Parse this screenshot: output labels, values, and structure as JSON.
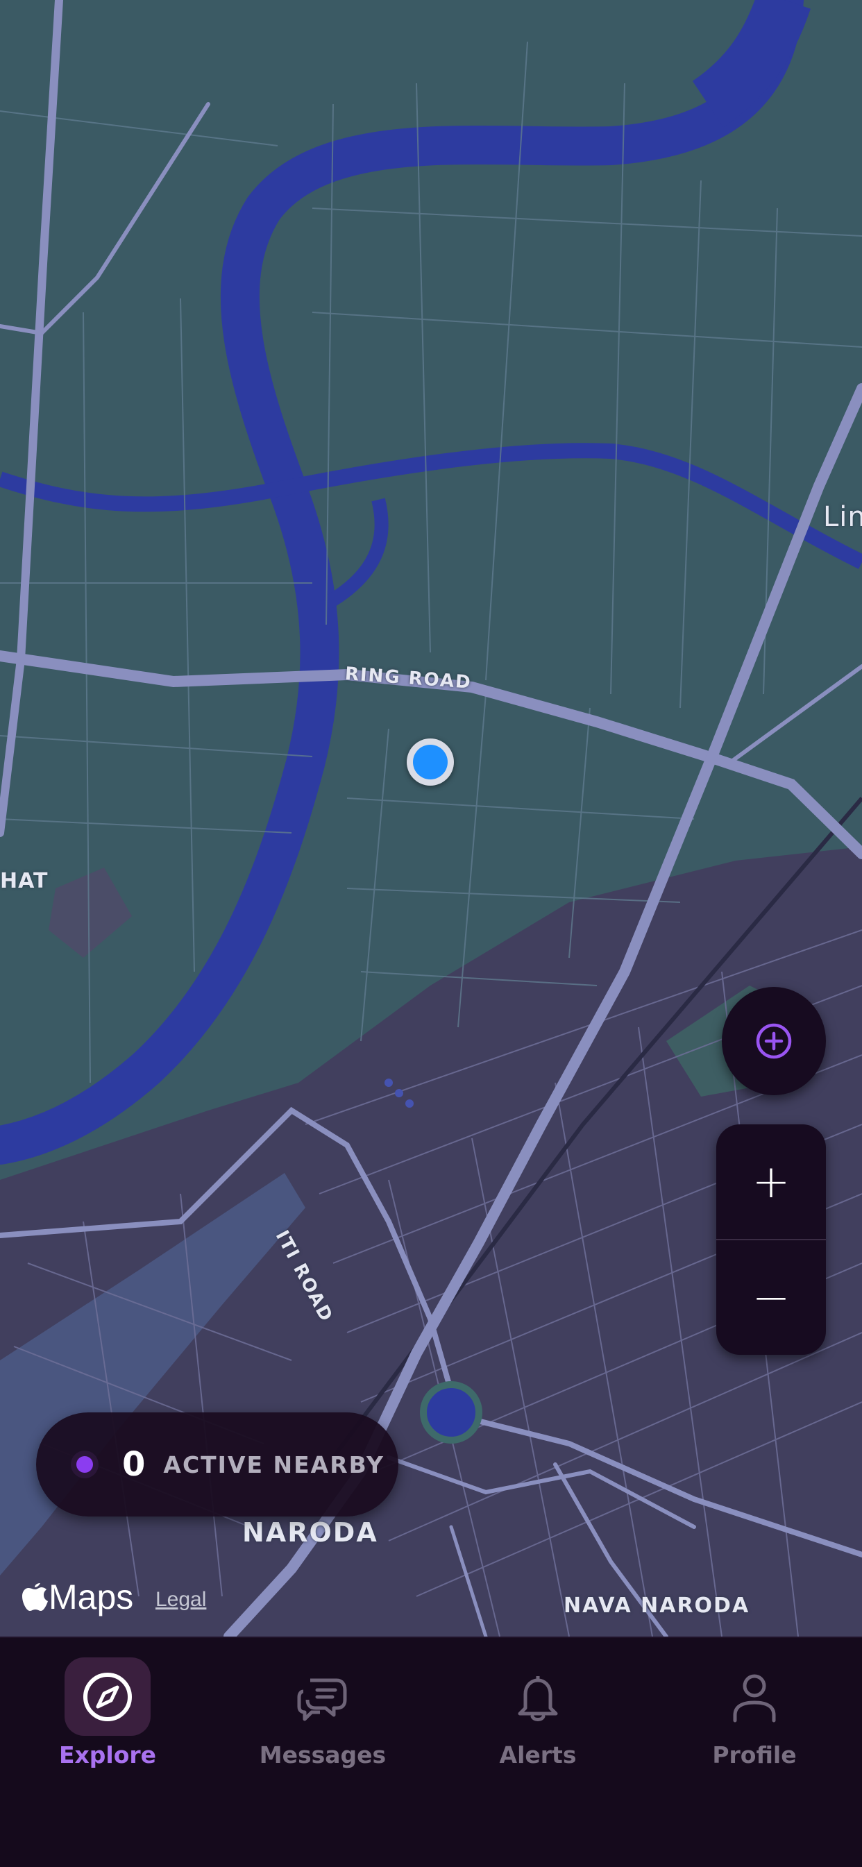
{
  "map": {
    "labels": {
      "ring_road": "RING ROAD",
      "iti_road": "ITI ROAD",
      "naroda": "NARODA",
      "nava_naroda": "NAVA NARODA",
      "hat": "HAT",
      "lin": "Lin"
    },
    "attribution": {
      "brand": "Maps",
      "legal": "Legal"
    }
  },
  "active_nearby": {
    "count": "0",
    "label": "ACTIVE NEARBY"
  },
  "zoom": {
    "in": "+",
    "out": "−"
  },
  "tabs": [
    {
      "id": "explore",
      "label": "Explore",
      "icon": "compass-icon",
      "active": true
    },
    {
      "id": "messages",
      "label": "Messages",
      "icon": "chat-bubbles-icon",
      "active": false
    },
    {
      "id": "alerts",
      "label": "Alerts",
      "icon": "bell-icon",
      "active": false
    },
    {
      "id": "profile",
      "label": "Profile",
      "icon": "person-icon",
      "active": false
    }
  ],
  "colors": {
    "accent": "#a972f0",
    "user_location": "#1e90ff",
    "river": "#2d3ba0",
    "land": "#3b5a64",
    "urban": "#413f5e",
    "road": "#8a8fbf"
  }
}
